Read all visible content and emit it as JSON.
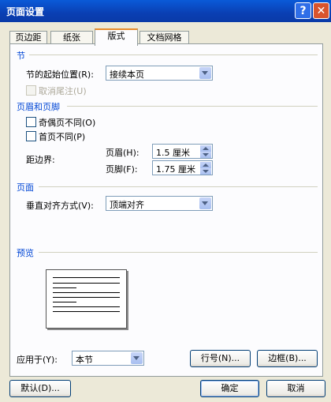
{
  "window": {
    "title": "页面设置",
    "help_label": "?",
    "close_label": "✕"
  },
  "tabs": [
    "页边距",
    "纸张",
    "版式",
    "文档网格"
  ],
  "section": {
    "header": "节",
    "start_label": "节的起始位置(R):",
    "start_value": "接续本页",
    "suppress_endnotes_label": "取消尾注(U)"
  },
  "headers_footers": {
    "header": "页眉和页脚",
    "odd_even_label": "奇偶页不同(O)",
    "first_page_label": "首页不同(P)",
    "from_edge_label": "距边界:",
    "header_label": "页眉(H):",
    "header_value": "1.5 厘米",
    "footer_label": "页脚(F):",
    "footer_value": "1.75 厘米"
  },
  "page": {
    "header": "页面",
    "valign_label": "垂直对齐方式(V):",
    "valign_value": "顶端对齐"
  },
  "preview": {
    "header": "预览"
  },
  "apply": {
    "label": "应用于(Y):",
    "value": "本节"
  },
  "buttons": {
    "line_numbers": "行号(N)...",
    "borders": "边框(B)...",
    "default": "默认(D)...",
    "ok": "确定",
    "cancel": "取消"
  }
}
